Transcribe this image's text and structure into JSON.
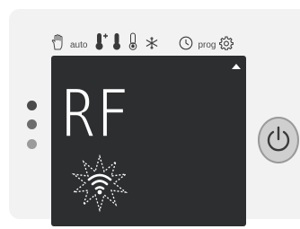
{
  "modes": {
    "hand_icon": "hand-icon",
    "auto_label": "auto",
    "thermo_plus_icon": "thermometer-plus-icon",
    "thermo_full_icon": "thermometer-full-icon",
    "thermo_empty_icon": "thermometer-empty-icon",
    "snowflake_icon": "snowflake-icon",
    "clock_icon": "clock-icon",
    "prog_label": "prog",
    "gear_icon": "gear-icon"
  },
  "display": {
    "text": "RF",
    "wifi_icon": "wifi-icon"
  },
  "colors": {
    "screen_bg": "#2d2e30",
    "segment": "#ffffff",
    "panel": "#f2f2f2"
  }
}
